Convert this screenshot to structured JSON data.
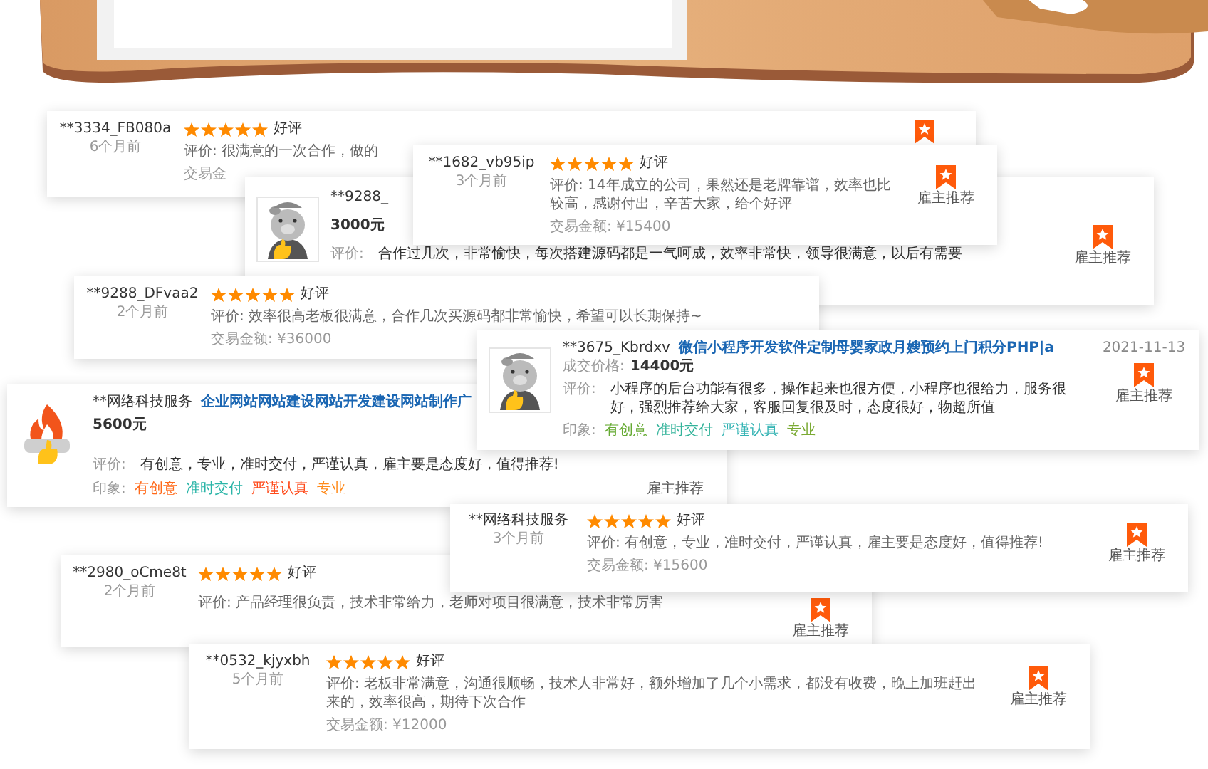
{
  "cards": [
    {
      "kind": "compact",
      "user": "**3334_FB080a",
      "time": "6个月前",
      "stars": 5,
      "rating": "好评",
      "comment": "评价: 很满意的一次合作，做的",
      "amount": "交易金",
      "badge": {
        "icon": true
      }
    },
    {
      "kind": "detailed",
      "avatar": {
        "kind": "mascot"
      },
      "user": "**9288_",
      "budget": "3000元",
      "comment_label": "评价:",
      "comment": "合作过几次，非常愉快，每次搭建源码都是一气呵成，效率非常快，领导很满意，以后有需要",
      "badge": {
        "icon": true,
        "label": "雇主推荐"
      }
    },
    {
      "kind": "compact",
      "user": "**1682_vb95ip",
      "time": "3个月前",
      "stars": 5,
      "rating": "好评",
      "comment": "评价: 14年成立的公司，果然还是老牌靠谱，效率也比较高，感谢付出，辛苦大家，给个好评",
      "amount": "交易金额: ¥15400",
      "badge": {
        "icon": true,
        "label": "雇主推荐"
      }
    },
    {
      "kind": "compact",
      "user": "**9288_DFvaa2",
      "time": "2个月前",
      "stars": 5,
      "rating": "好评",
      "comment": "评价: 效率很高老板很满意，合作几次买源码都非常愉快，希望可以长期保持~",
      "amount": "交易金额: ¥36000"
    },
    {
      "kind": "detailed",
      "avatar": {
        "kind": "flame"
      },
      "user": "**网络科技服务",
      "project": "企业网站网站建设网站开发建设网站制作广",
      "budget": "5600元",
      "comment_label": "评价:",
      "comment": "有创意，专业，准时交付，严谨认真，雇主要是态度好，值得推荐!",
      "impressions_label": "印象:",
      "impressions": [
        {
          "label": "有创意",
          "color": "#ff6a1a"
        },
        {
          "label": "准时交付",
          "color": "#2bb5a8"
        },
        {
          "label": "严谨认真",
          "color": "#ff4a1a"
        },
        {
          "label": "专业",
          "color": "#ff8a1a"
        }
      ],
      "badge": {
        "icon": false,
        "label": "雇主推荐"
      }
    },
    {
      "kind": "detailed",
      "avatar": {
        "kind": "mascot"
      },
      "user": "**3675_Kbrdxv",
      "project": "微信小程序开发软件定制母婴家政月嫂预约上门积分PHP|a",
      "deal_label": "成交价格:",
      "deal_price": "14400元",
      "date": "2021-11-13",
      "comment_label": "评价:",
      "comment": "小程序的后台功能有很多，操作起来也很方便，小程序也很给力，服务很好，强烈推荐给大家，客服回复很及时，态度很好，物超所值",
      "impressions_label": "印象:",
      "impressions": [
        {
          "label": "有创意",
          "color": "#66aa33"
        },
        {
          "label": "准时交付",
          "color": "#33b39a"
        },
        {
          "label": "严谨认真",
          "color": "#33b3b3"
        },
        {
          "label": "专业",
          "color": "#7aaa33"
        }
      ],
      "badge": {
        "icon": true,
        "label": "雇主推荐"
      }
    },
    {
      "kind": "compact",
      "user": "**网络科技服务",
      "time": "3个月前",
      "stars": 5,
      "rating": "好评",
      "comment": "评价: 有创意，专业，准时交付，严谨认真，雇主要是态度好，值得推荐!",
      "amount": "交易金额: ¥15600",
      "badge": {
        "icon": true,
        "label": "雇主推荐"
      }
    },
    {
      "kind": "compact",
      "user": "**2980_oCme8t",
      "time": "2个月前",
      "stars": 5,
      "rating": "好评",
      "comment": "评价: 产品经理很负责，技术非常给力，老师对项目很满意，技术非常厉害",
      "badge": {
        "icon": true,
        "label": "雇主推荐"
      }
    },
    {
      "kind": "compact",
      "user": "**0532_kjyxbh",
      "time": "5个月前",
      "stars": 5,
      "rating": "好评",
      "comment": "评价: 老板非常满意，沟通很顺畅，技术人非常好，额外增加了几个小需求，都没有收费，晚上加班赶出来的，效率很高，期待下次合作",
      "amount": "交易金额: ¥12000",
      "badge": {
        "icon": true,
        "label": "雇主推荐"
      }
    }
  ]
}
